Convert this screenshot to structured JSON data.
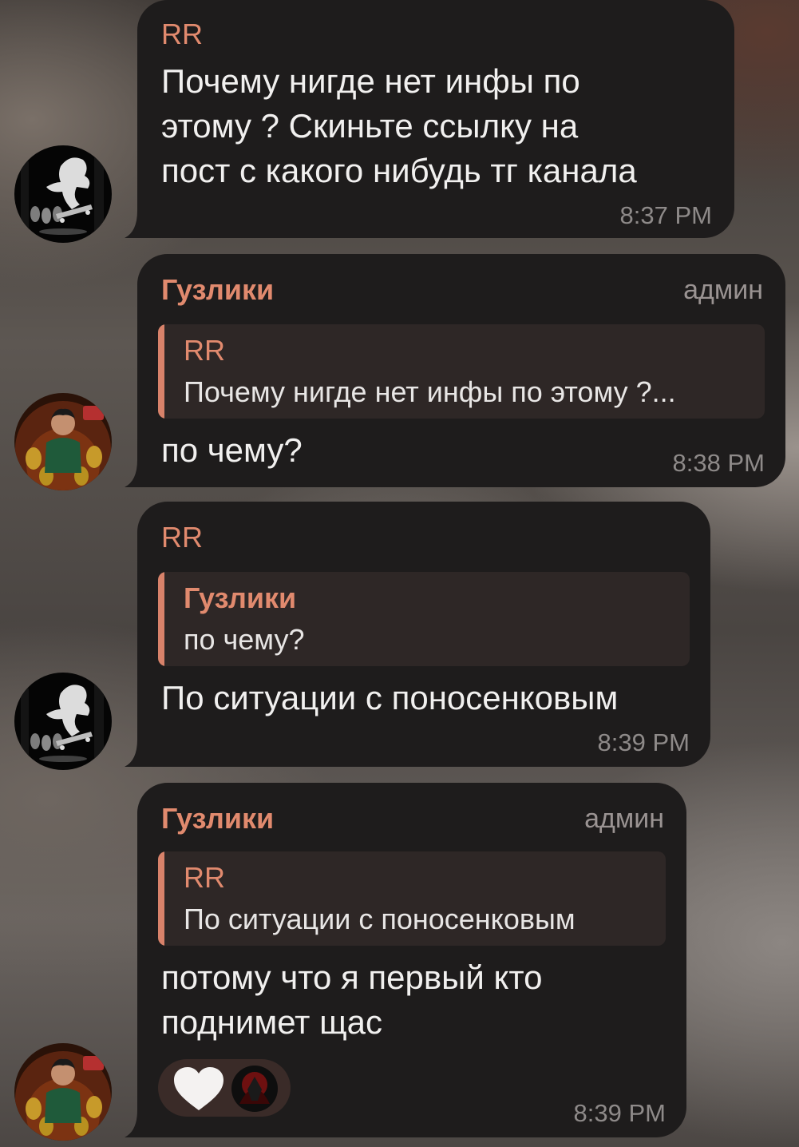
{
  "colors": {
    "bubble_bg": "#1e1c1c",
    "accent_name": "#e18a6e",
    "reply_bg": "#2e2726",
    "reply_bar": "#d8826a",
    "text": "#f1f0ef",
    "time": "#8e8a89"
  },
  "messages": [
    {
      "sender": "RR",
      "text": "Почему нигде нет инфы по\nэтому ? Скиньте ссылку на\nпост с какого нибудь тг канала",
      "time": "8:37 PM",
      "avatar_icon": "skater-avatar-icon"
    },
    {
      "sender": "Гузлики",
      "role": "админ",
      "reply": {
        "sender": "RR",
        "text": "Почему нигде нет инфы по этому ?..."
      },
      "text": "по чему?",
      "time": "8:38 PM",
      "avatar_icon": "character-avatar-icon"
    },
    {
      "sender": "RR",
      "reply": {
        "sender": "Гузлики",
        "text": "по чему?"
      },
      "text": "По ситуации с поносенковым",
      "time": "8:39 PM",
      "avatar_icon": "skater-avatar-icon"
    },
    {
      "sender": "Гузлики",
      "role": "админ",
      "reply": {
        "sender": "RR",
        "text": "По ситуации с поносенковым"
      },
      "text": "потому что я первый кто\nподнимет щас",
      "time": "8:39 PM",
      "reactions": [
        "heart-icon",
        "reactor-avatar-icon"
      ],
      "avatar_icon": "character-avatar-icon"
    }
  ]
}
